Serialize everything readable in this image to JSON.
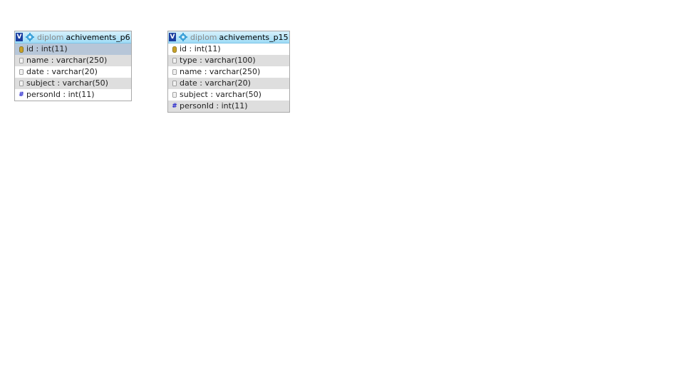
{
  "tables": [
    {
      "db": "diplom",
      "name": "achivements_p6",
      "toggle": "V",
      "columns": [
        {
          "text": "id : int(11)",
          "icon": "key-icon",
          "selected": true
        },
        {
          "text": "name : varchar(250)",
          "icon": "column-icon"
        },
        {
          "text": "date : varchar(20)",
          "icon": "column-icon"
        },
        {
          "text": "subject : varchar(50)",
          "icon": "column-icon"
        },
        {
          "text": "personId : int(11)",
          "icon": "hash-icon"
        }
      ]
    },
    {
      "db": "diplom",
      "name": "achivements_p15",
      "toggle": "V",
      "columns": [
        {
          "text": "id : int(11)",
          "icon": "key-icon"
        },
        {
          "text": "type : varchar(100)",
          "icon": "column-icon"
        },
        {
          "text": "name : varchar(250)",
          "icon": "column-icon"
        },
        {
          "text": "date : varchar(20)",
          "icon": "column-icon"
        },
        {
          "text": "subject : varchar(50)",
          "icon": "column-icon"
        },
        {
          "text": "personId : int(11)",
          "icon": "hash-icon"
        }
      ]
    }
  ],
  "colors": {
    "header_start": "#d6f0fb",
    "header_end": "#9fdcf6",
    "toggle_bg": "#1b3fa0",
    "row_alt": "#dedede",
    "row_selected": "#b7c6d8",
    "key_color": "#c9a227",
    "hash_color": "#2222cc"
  }
}
